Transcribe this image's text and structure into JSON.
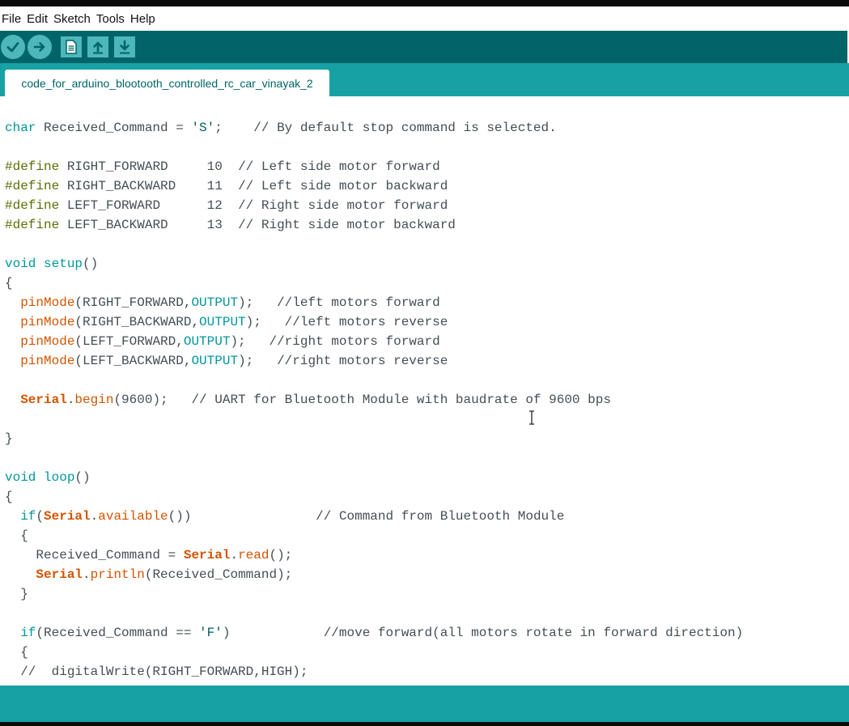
{
  "menu": [
    "File",
    "Edit",
    "Sketch",
    "Tools",
    "Help"
  ],
  "toolbar": {
    "buttons": [
      {
        "name": "verify",
        "icon": "check-icon"
      },
      {
        "name": "upload",
        "icon": "arrow-right-icon"
      },
      {
        "name": "new",
        "icon": "document-icon"
      },
      {
        "name": "open",
        "icon": "arrow-up-icon"
      },
      {
        "name": "save",
        "icon": "arrow-down-icon"
      }
    ]
  },
  "tab": {
    "label": "code_for_arduino_blootooth_controlled_rc_car_vinayak_2"
  },
  "colors": {
    "toolbar": "#006468",
    "tabbar": "#17a1a5",
    "button": "#4db7bb",
    "keyword": "#00979c",
    "function": "#d35400",
    "preprocessor": "#5e6d03"
  },
  "code_lines": [
    [
      [
        "kw",
        "char"
      ],
      [
        "t",
        " Received_Command = "
      ],
      [
        "str",
        "'S'"
      ],
      [
        "t",
        ";    "
      ],
      [
        "com",
        "// By default stop command is selected."
      ]
    ],
    [],
    [
      [
        "pre",
        "#define"
      ],
      [
        "t",
        " RIGHT_FORWARD     10  "
      ],
      [
        "com",
        "// Left side motor forward"
      ]
    ],
    [
      [
        "pre",
        "#define"
      ],
      [
        "t",
        " RIGHT_BACKWARD    11  "
      ],
      [
        "com",
        "// Left side motor backward"
      ]
    ],
    [
      [
        "pre",
        "#define"
      ],
      [
        "t",
        " LEFT_FORWARD      12  "
      ],
      [
        "com",
        "// Right side motor forward"
      ]
    ],
    [
      [
        "pre",
        "#define"
      ],
      [
        "t",
        " LEFT_BACKWARD     13  "
      ],
      [
        "com",
        "// Right side motor backward"
      ]
    ],
    [],
    [
      [
        "kw",
        "void"
      ],
      [
        "t",
        " "
      ],
      [
        "kw",
        "setup"
      ],
      [
        "t",
        "()"
      ]
    ],
    [
      [
        "t",
        "{"
      ]
    ],
    [
      [
        "t",
        "  "
      ],
      [
        "fn",
        "pinMode"
      ],
      [
        "t",
        "(RIGHT_FORWARD,"
      ],
      [
        "kw",
        "OUTPUT"
      ],
      [
        "t",
        ");   "
      ],
      [
        "com",
        "//left motors forward"
      ]
    ],
    [
      [
        "t",
        "  "
      ],
      [
        "fn",
        "pinMode"
      ],
      [
        "t",
        "(RIGHT_BACKWARD,"
      ],
      [
        "kw",
        "OUTPUT"
      ],
      [
        "t",
        ");   "
      ],
      [
        "com",
        "//left motors reverse"
      ]
    ],
    [
      [
        "t",
        "  "
      ],
      [
        "fn",
        "pinMode"
      ],
      [
        "t",
        "(LEFT_FORWARD,"
      ],
      [
        "kw",
        "OUTPUT"
      ],
      [
        "t",
        ");   "
      ],
      [
        "com",
        "//right motors forward"
      ]
    ],
    [
      [
        "t",
        "  "
      ],
      [
        "fn",
        "pinMode"
      ],
      [
        "t",
        "(LEFT_BACKWARD,"
      ],
      [
        "kw",
        "OUTPUT"
      ],
      [
        "t",
        ");   "
      ],
      [
        "com",
        "//right motors reverse"
      ]
    ],
    [],
    [
      [
        "t",
        "  "
      ],
      [
        "obj",
        "Serial"
      ],
      [
        "t",
        "."
      ],
      [
        "fn",
        "begin"
      ],
      [
        "t",
        "(9600);   "
      ],
      [
        "com",
        "// UART for Bluetooth Module with baudrate of 9600 bps"
      ]
    ],
    [],
    [
      [
        "t",
        "}"
      ]
    ],
    [],
    [
      [
        "kw",
        "void"
      ],
      [
        "t",
        " "
      ],
      [
        "kw",
        "loop"
      ],
      [
        "t",
        "()"
      ]
    ],
    [
      [
        "t",
        "{"
      ]
    ],
    [
      [
        "t",
        "  "
      ],
      [
        "kw",
        "if"
      ],
      [
        "t",
        "("
      ],
      [
        "obj",
        "Serial"
      ],
      [
        "t",
        "."
      ],
      [
        "fn",
        "available"
      ],
      [
        "t",
        "())                "
      ],
      [
        "com",
        "// Command from Bluetooth Module"
      ]
    ],
    [
      [
        "t",
        "  {"
      ]
    ],
    [
      [
        "t",
        "    Received_Command = "
      ],
      [
        "obj",
        "Serial"
      ],
      [
        "t",
        "."
      ],
      [
        "fn",
        "read"
      ],
      [
        "t",
        "();"
      ]
    ],
    [
      [
        "t",
        "    "
      ],
      [
        "obj",
        "Serial"
      ],
      [
        "t",
        "."
      ],
      [
        "fn",
        "println"
      ],
      [
        "t",
        "(Received_Command);"
      ]
    ],
    [
      [
        "t",
        "  }"
      ]
    ],
    [],
    [
      [
        "t",
        "  "
      ],
      [
        "kw",
        "if"
      ],
      [
        "t",
        "(Received_Command == "
      ],
      [
        "str",
        "'F'"
      ],
      [
        "t",
        ")            "
      ],
      [
        "com",
        "//move forward(all motors rotate in forward direction)"
      ]
    ],
    [
      [
        "t",
        "  {"
      ]
    ],
    [
      [
        "t",
        "  "
      ],
      [
        "com",
        "//  digitalWrite(RIGHT_FORWARD,HIGH);"
      ]
    ]
  ]
}
